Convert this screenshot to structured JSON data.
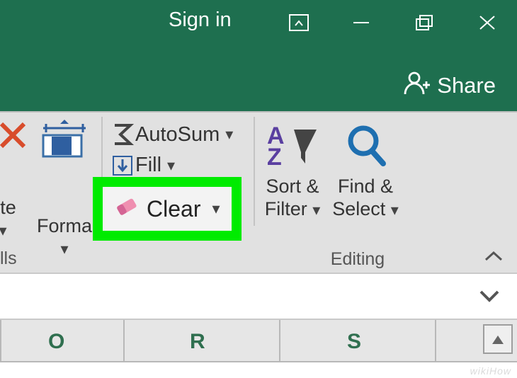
{
  "titlebar": {
    "signin_label": "Sign in",
    "share_label": "Share"
  },
  "ribbon": {
    "cells_group_label": "lls",
    "delete_label": "ete",
    "format_label": "Forma",
    "autosum_label": "AutoSum",
    "fill_label": "Fill",
    "clear_label": "Clear",
    "sort_filter_line1": "Sort &",
    "sort_filter_line2": "Filter",
    "find_select_line1": "Find &",
    "find_select_line2": "Select",
    "editing_group_label": "Editing"
  },
  "columns": {
    "o": "O",
    "r": "R",
    "s": "S"
  },
  "watermark": "wikiHow"
}
